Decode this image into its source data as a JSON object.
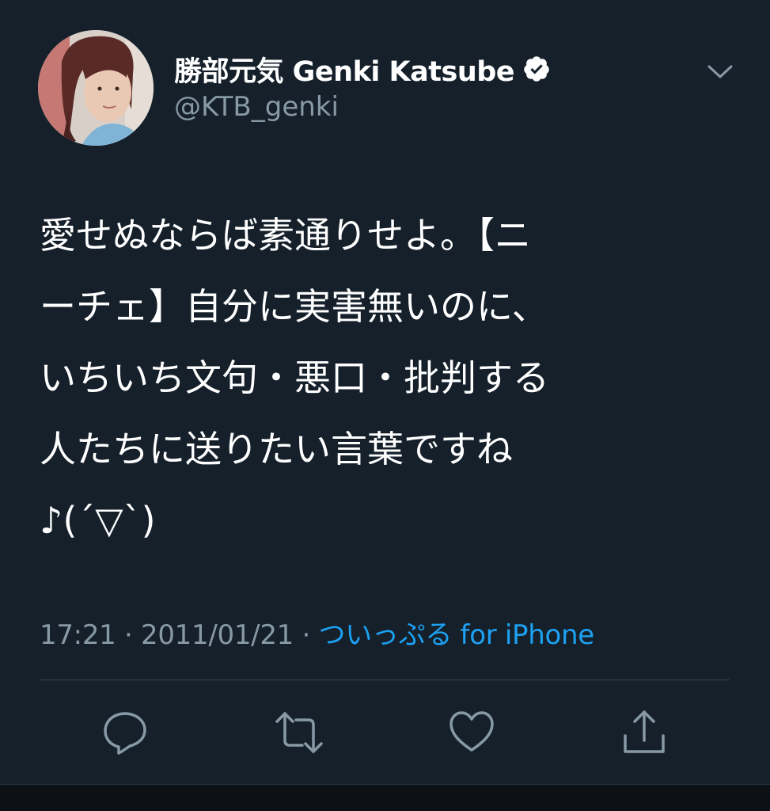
{
  "author": {
    "display_name": "勝部元気 Genki Katsube",
    "handle": "@KTB_genki",
    "verified": true
  },
  "tweet": {
    "lines": [
      "愛せぬならば素通りせよ。【ニ",
      "ーチェ】自分に実害無いのに、",
      "いちいち文句・悪口・批判する",
      "人たちに送りたい言葉ですね",
      "♪(´▽`)"
    ]
  },
  "meta": {
    "time": "17:21",
    "separator1": " · ",
    "date": "2011/01/21",
    "separator2": " · ",
    "source": "ついっぷる for iPhone"
  },
  "colors": {
    "background": "#15202b",
    "primary_text": "#ffffff",
    "secondary_text": "#8899a6",
    "link": "#1da1f2",
    "divider": "#38444d"
  },
  "icons": {
    "reply": "reply-icon",
    "retweet": "retweet-icon",
    "like": "heart-icon",
    "share": "share-icon",
    "more": "chevron-down-icon",
    "verified": "verified-badge-icon"
  }
}
